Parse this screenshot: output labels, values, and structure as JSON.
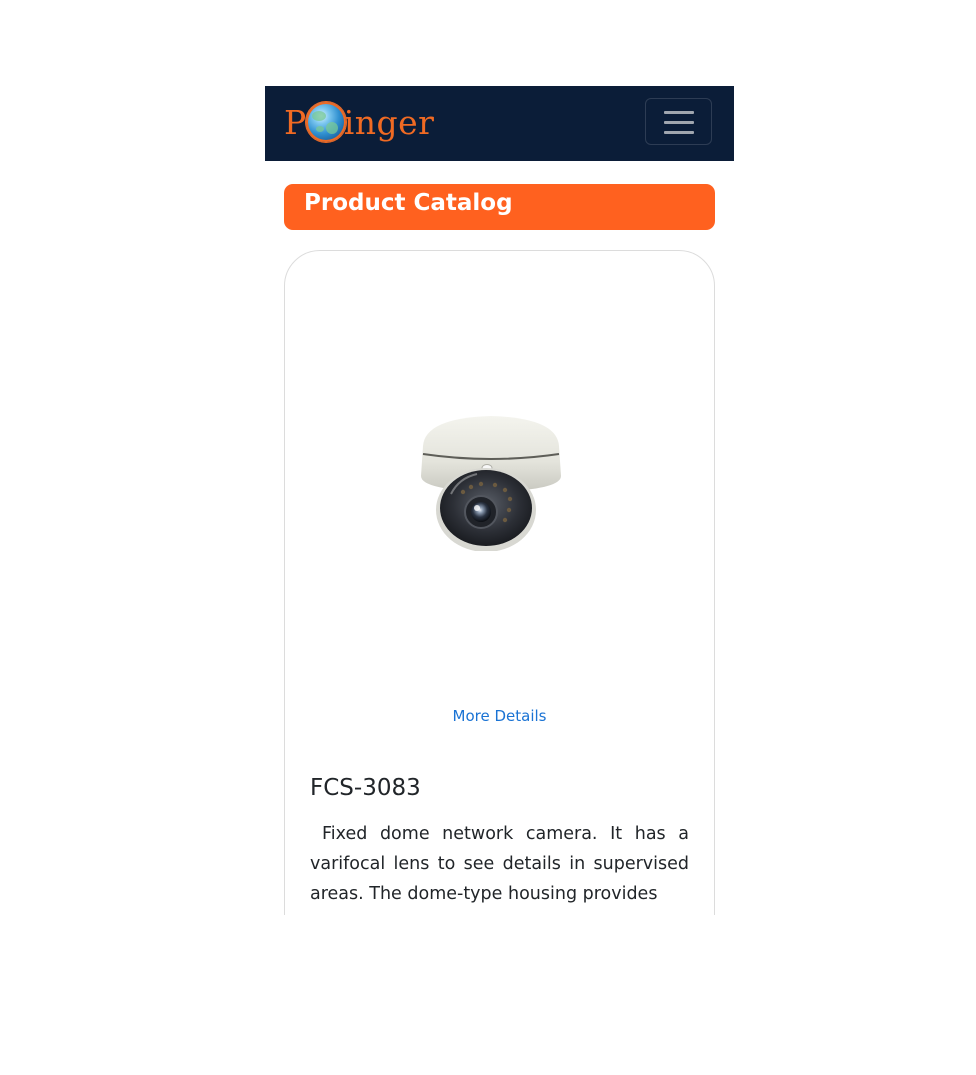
{
  "navbar": {
    "logo_text_before": "P",
    "logo_text_after": "inger",
    "logo_icon": "globe-icon",
    "toggler_icon": "hamburger-menu-icon",
    "background_color": "#0b1d38",
    "logo_color": "#f06a23"
  },
  "catalog": {
    "title": "Product Catalog",
    "accent_color": "#ff611f"
  },
  "product": {
    "image_icon": "dome-camera-image",
    "more_details_label": "More Details",
    "name": "FCS-3083",
    "description": "Fixed dome network camera. It has a varifocal lens to see details in supervised areas. The dome-type housing provides"
  },
  "colors": {
    "link": "#1a73d4",
    "text": "#212529",
    "card_border": "#dcdcdc"
  }
}
